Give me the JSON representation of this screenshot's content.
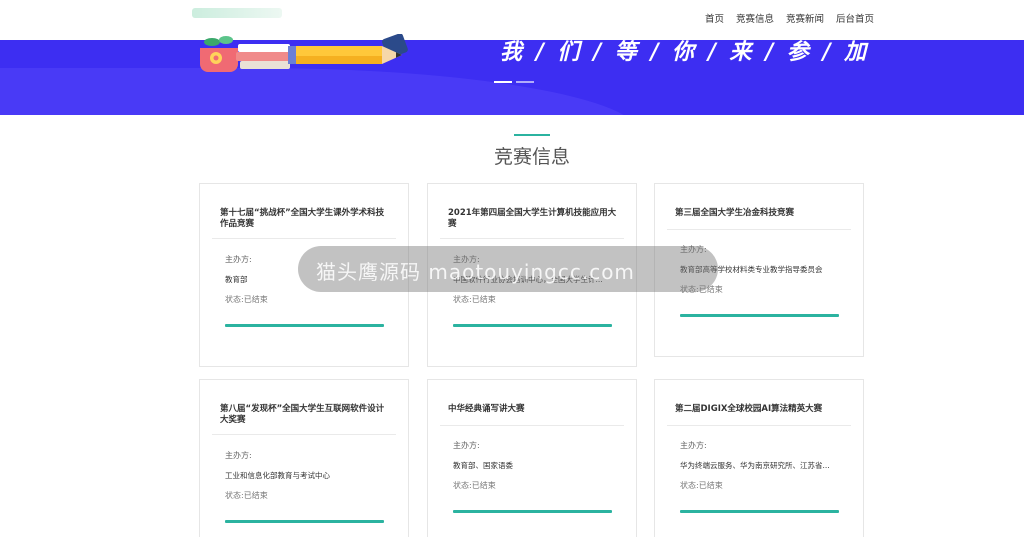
{
  "nav": {
    "items": [
      "首页",
      "竞赛信息",
      "竞赛新闻",
      "后台首页"
    ]
  },
  "banner": {
    "slogan": "我 / 们 / 等 / 你 / 来 / 参 / 加"
  },
  "section": {
    "title": "竞赛信息"
  },
  "cards": [
    {
      "title": "第十七届“挑战杯”全国大学生课外学术科技作品竞赛",
      "host_label": "主办方:",
      "host": "教育部",
      "status": "状态:已结束"
    },
    {
      "title": "2021年第四届全国大学生计算机技能应用大赛",
      "host_label": "主办方:",
      "host": "中国软件行业协会培训中心，全国大学生计...",
      "status": "状态:已结束"
    },
    {
      "title": "第三届全国大学生冶金科技竞赛",
      "host_label": "主办方:",
      "host": "教育部高等学校材料类专业教学指导委员会",
      "status": "状态:已结束"
    },
    {
      "title": "第八届“发现杯”全国大学生互联网软件设计大奖赛",
      "host_label": "主办方:",
      "host": "工业和信息化部教育与考试中心",
      "status": "状态:已结束"
    },
    {
      "title": "中华经典诵写讲大赛",
      "host_label": "主办方:",
      "host": "教育部、国家语委",
      "status": "状态:已结束"
    },
    {
      "title": "第二届DIGIX全球校园AI算法精英大赛",
      "host_label": "主办方:",
      "host": "华为终端云服务、华为南京研究所、江苏省...",
      "status": "状态:已结束"
    }
  ],
  "watermark": {
    "text": "猫头鹰源码 maotouyingcc.com"
  },
  "colors": {
    "banner": "#3d2ef2",
    "accent": "#2bb3a0"
  }
}
